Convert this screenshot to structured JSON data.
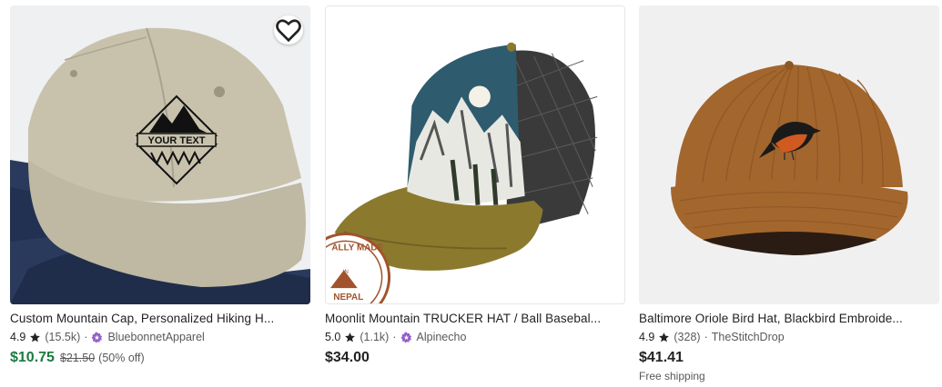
{
  "colors": {
    "sale_price": "#1a7a41",
    "star_badge": "#9560c9",
    "text": "#222222",
    "muted": "#595959"
  },
  "listings": [
    {
      "title": "Custom Mountain Cap, Personalized Hiking H...",
      "rating": "4.9",
      "review_count": "(15.5k)",
      "seller": "BluebonnetApparel",
      "star_seller": true,
      "price": "$10.75",
      "original_price": "$21.50",
      "discount": "(50% off)",
      "favorite_icon": "heart-outline-icon",
      "image_text": "YOUR TEXT"
    },
    {
      "title": "Moonlit Mountain TRUCKER HAT / Ball Basebal...",
      "rating": "5.0",
      "review_count": "(1.1k)",
      "seller": "Alpinecho",
      "star_seller": true,
      "price": "$34.00",
      "image_badge_text_1": "ALLY MADE",
      "image_badge_text_2": "IN",
      "image_badge_text_3": "NEPAL"
    },
    {
      "title": "Baltimore Oriole Bird Hat, Blackbird Embroide...",
      "rating": "4.9",
      "review_count": "(328)",
      "seller": "TheStitchDrop",
      "star_seller": false,
      "price": "$41.41",
      "shipping": "Free shipping"
    }
  ]
}
